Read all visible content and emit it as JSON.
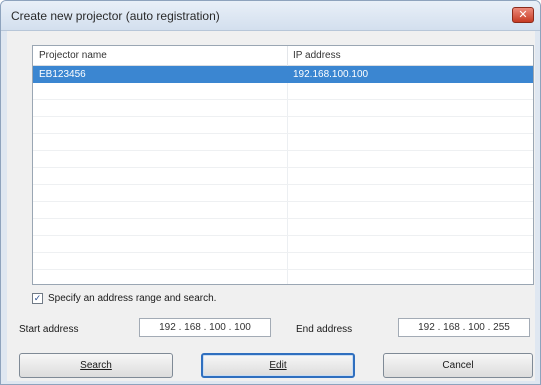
{
  "window": {
    "title": "Create new projector (auto registration)",
    "close_label": "✕"
  },
  "list": {
    "columns": [
      "Projector name",
      "IP address"
    ],
    "rows": [
      {
        "name": "EB123456",
        "ip": "192.168.100.100",
        "selected": true
      }
    ],
    "selected_color": "#3b86d1"
  },
  "search_option": {
    "checked": true,
    "label": "Specify an address range and search."
  },
  "address": {
    "start_label": "Start address",
    "start_value": "192 . 168 . 100 . 100",
    "end_label": "End address",
    "end_value": "192 . 168 . 100 . 255"
  },
  "buttons": {
    "search": "Search",
    "edit": "Edit",
    "cancel": "Cancel"
  },
  "icons": {
    "close": "close-icon",
    "check": "checkmark-icon"
  }
}
